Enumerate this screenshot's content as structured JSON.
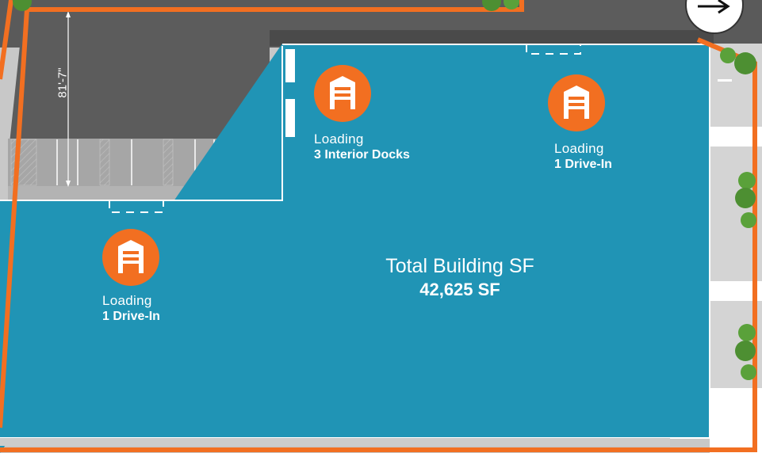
{
  "building": {
    "total_label": "Total Building SF",
    "total_value": "42,625 SF"
  },
  "loading": [
    {
      "label": "Loading",
      "detail": "3 Interior Docks"
    },
    {
      "label": "Loading",
      "detail": "1 Drive-In"
    },
    {
      "label": "Loading",
      "detail": "1 Drive-In"
    }
  ],
  "dimension": "81'-7\"",
  "icons": {
    "loading": "garage-door-icon",
    "direction": "arrow-right-icon"
  },
  "colors": {
    "building": "#2094b5",
    "paving": "#595959",
    "boundary": "#f26f21",
    "icon_bg": "#f26f21",
    "tree": "#4d8f32"
  }
}
